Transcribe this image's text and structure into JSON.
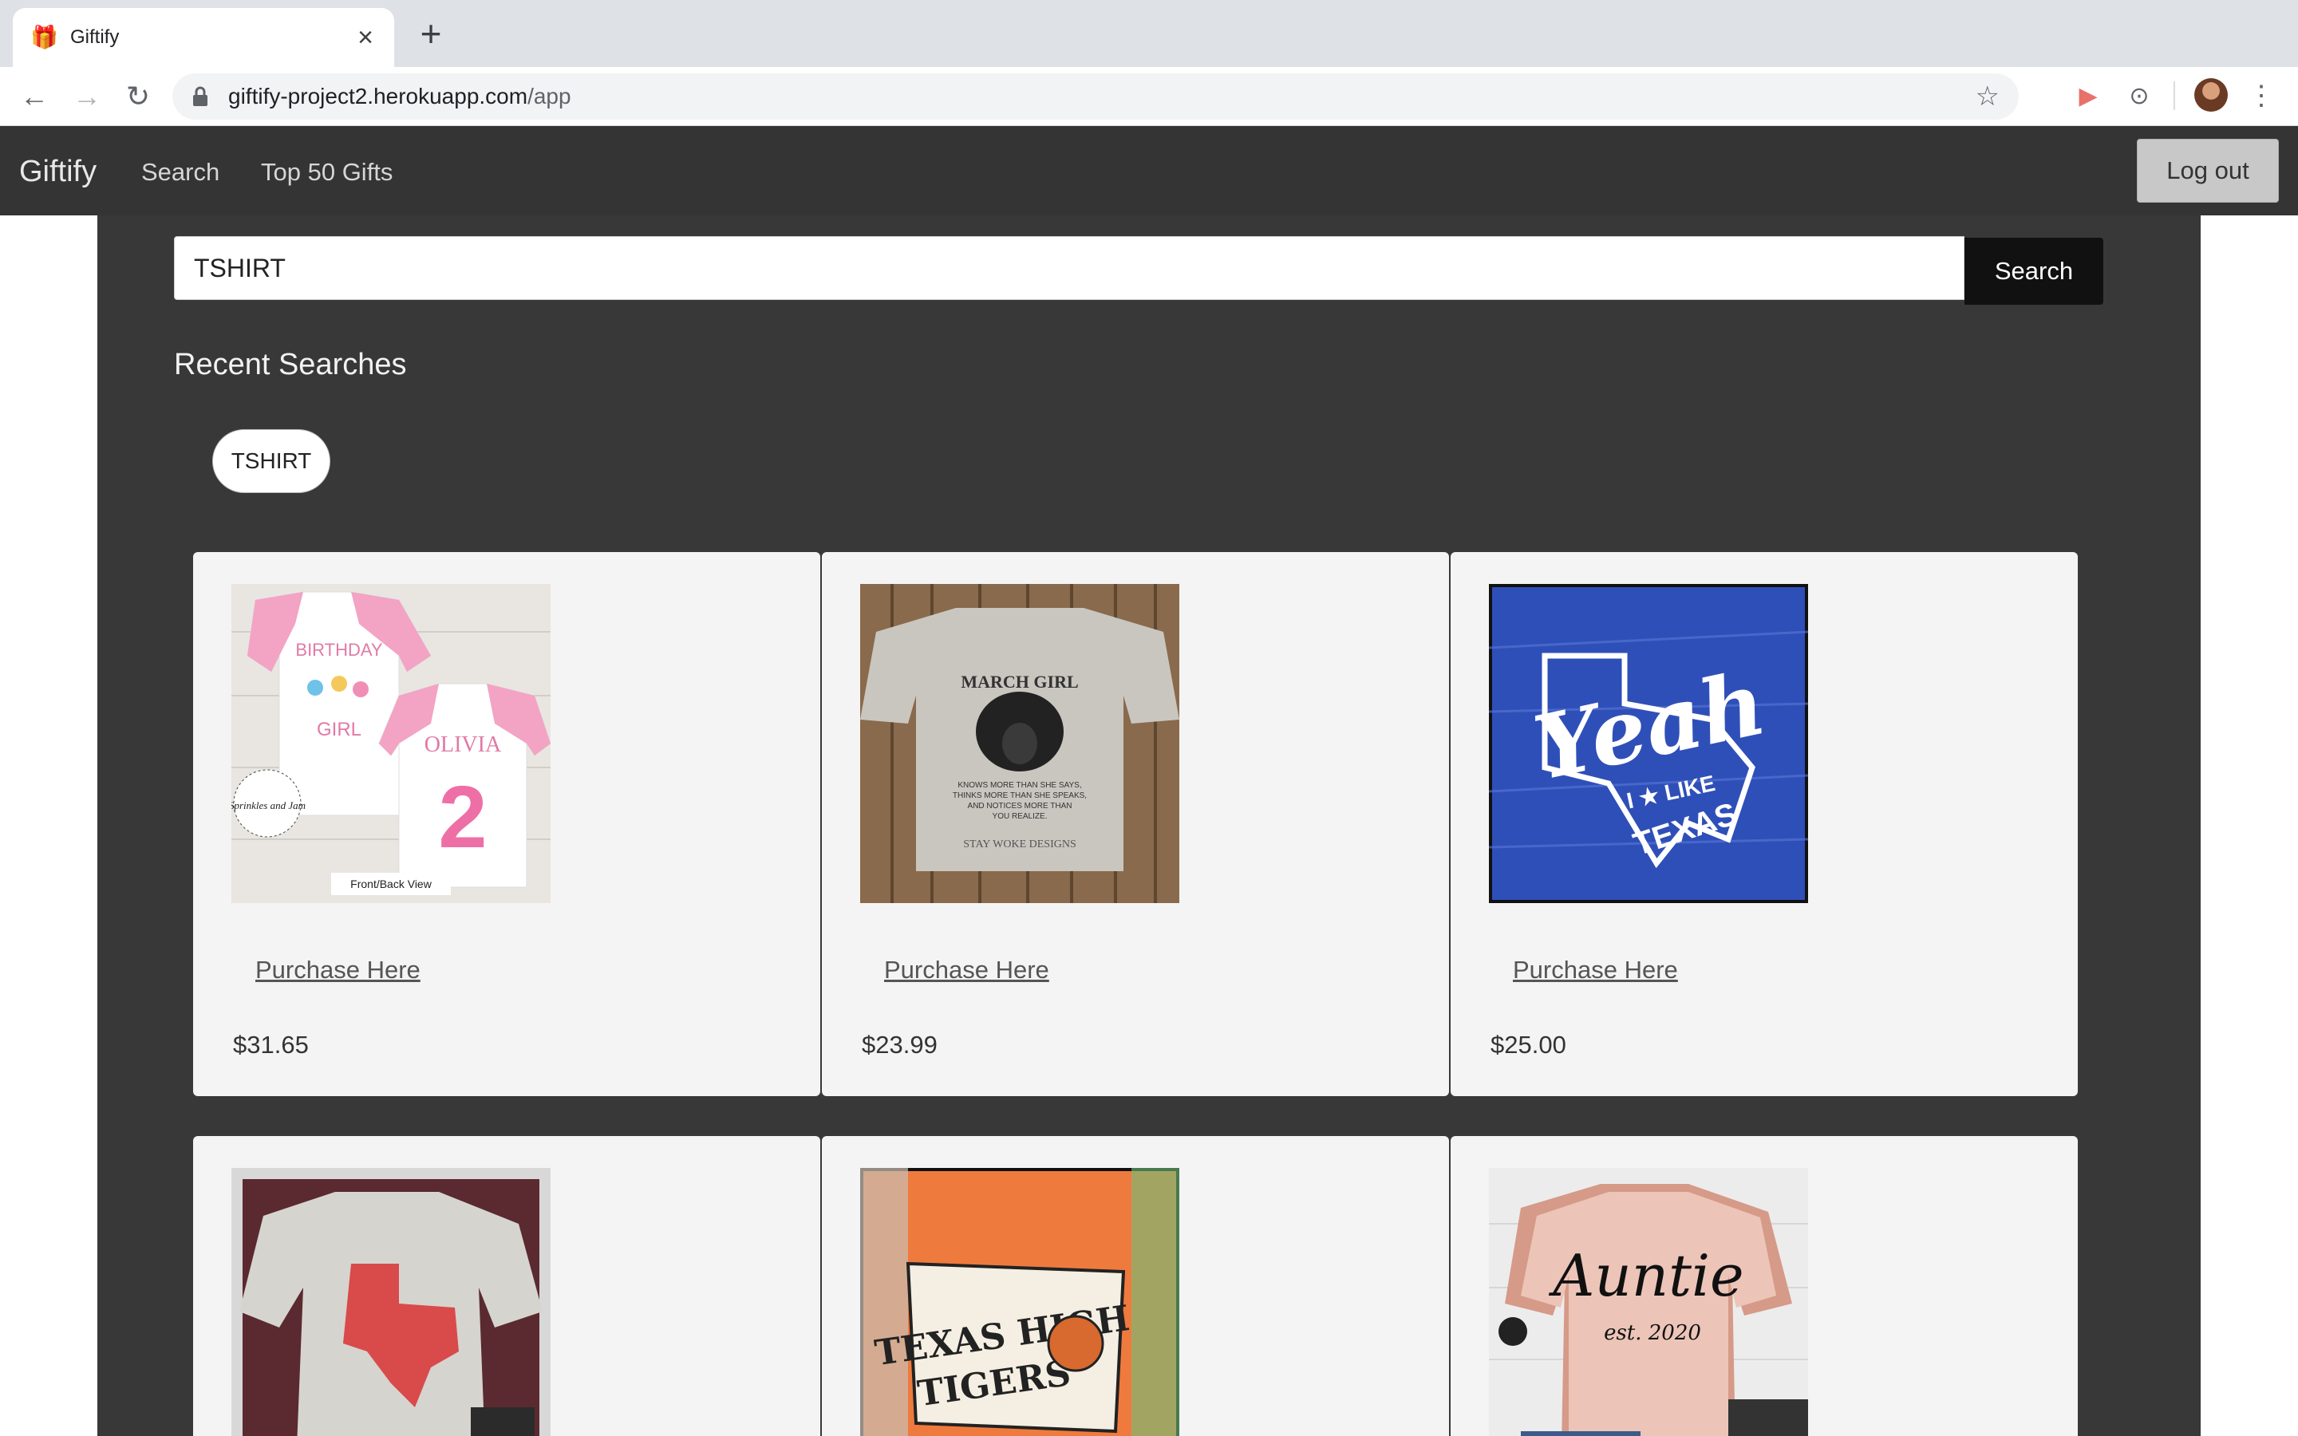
{
  "browser": {
    "tab_title": "Giftify",
    "url_host": "giftify-project2.herokuapp.com",
    "url_path": "/app"
  },
  "nav": {
    "brand": "Giftify",
    "links": [
      "Search",
      "Top 50 Gifts"
    ],
    "logout_label": "Log out"
  },
  "search": {
    "query": "TSHIRT",
    "button_label": "Search"
  },
  "recent": {
    "title": "Recent Searches",
    "items": [
      "TSHIRT"
    ]
  },
  "products": [
    {
      "link_label": "Purchase Here",
      "price": "$31.65",
      "image_text": [
        "BIRTHDAY",
        "GIRL",
        "OLIVIA",
        "2",
        "Sprinkles and Jam",
        "Front/Back View"
      ]
    },
    {
      "link_label": "Purchase Here",
      "price": "$23.99",
      "image_text": [
        "MARCH GIRL",
        "KNOWS MORE THAN SHE SAYS,",
        "THINKS MORE THAN SHE SPEAKS,",
        "AND NOTICES MORE THAN",
        "YOU REALIZE.",
        "STAY WOKE DESIGNS"
      ]
    },
    {
      "link_label": "Purchase Here",
      "price": "$25.00",
      "image_text": [
        "Yeah",
        "I ★ LIKE",
        "TEXAS"
      ]
    },
    {
      "image_text": []
    },
    {
      "image_text": [
        "TEXAS HIGH",
        "TIGERS"
      ]
    },
    {
      "image_text": [
        "Auntie",
        "est. 2020"
      ]
    }
  ]
}
